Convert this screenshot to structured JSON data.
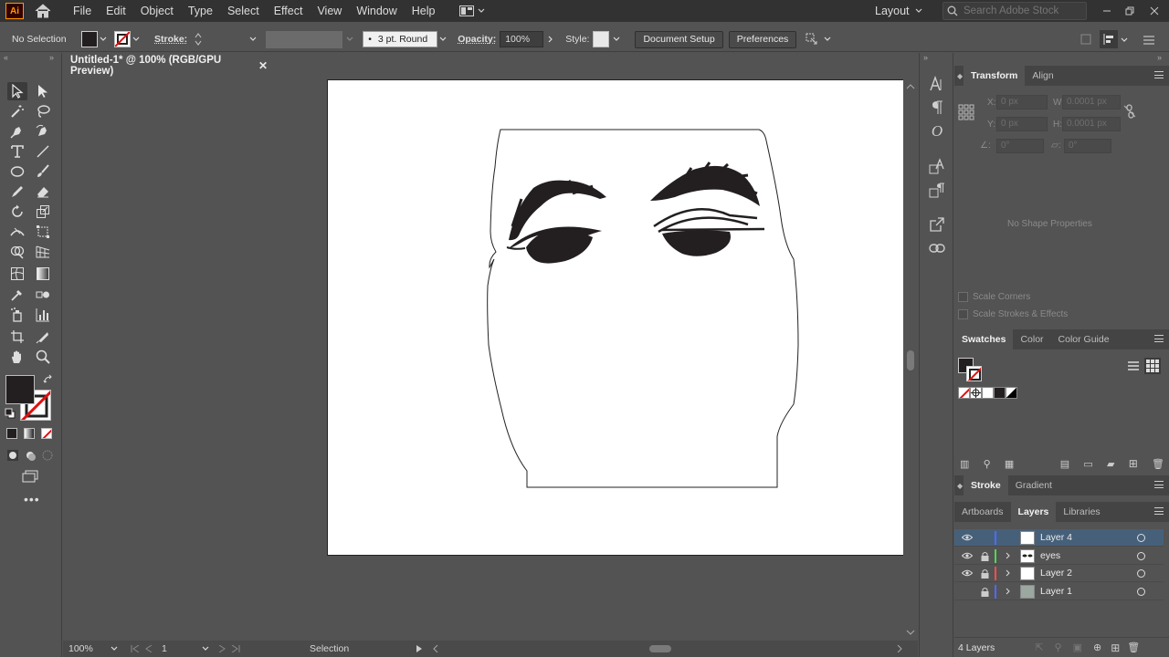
{
  "menubar": {
    "app_logo": "Ai",
    "items": [
      "File",
      "Edit",
      "Object",
      "Type",
      "Select",
      "Effect",
      "View",
      "Window",
      "Help"
    ],
    "workspace": "Layout",
    "search_placeholder": "Search Adobe Stock"
  },
  "controlbar": {
    "selection_label": "No Selection",
    "stroke_label": "Stroke:",
    "brush_value": "3 pt. Round",
    "opacity_label": "Opacity:",
    "opacity_value": "100%",
    "style_label": "Style:",
    "document_setup": "Document Setup",
    "preferences": "Preferences"
  },
  "document": {
    "tab_title": "Untitled-1* @ 100% (RGB/GPU Preview)"
  },
  "statusbar": {
    "zoom": "100%",
    "artboard_number": "1",
    "tool_name": "Selection"
  },
  "transform_panel": {
    "tabs": [
      "Transform",
      "Align"
    ],
    "x_label": "X:",
    "x_value": "0 px",
    "y_label": "Y:",
    "y_value": "0 px",
    "w_label": "W:",
    "w_value": "0.0001 px",
    "h_label": "H:",
    "h_value": "0.0001 px",
    "angle_value": "0°",
    "shear_value": "0°",
    "no_shape": "No Shape Properties",
    "scale_corners": "Scale Corners",
    "scale_strokes": "Scale Strokes & Effects"
  },
  "swatches_panel": {
    "tabs": [
      "Swatches",
      "Color",
      "Color Guide"
    ]
  },
  "stroke_panel": {
    "tabs": [
      "Stroke",
      "Gradient"
    ]
  },
  "layers_panel": {
    "tabs": [
      "Artboards",
      "Layers",
      "Libraries"
    ],
    "layers": [
      {
        "name": "Layer 4",
        "color": "#4f6bff",
        "visible": true,
        "locked": false,
        "selected": true
      },
      {
        "name": "eyes",
        "color": "#4fd84f",
        "visible": true,
        "locked": true,
        "selected": false
      },
      {
        "name": "Layer 2",
        "color": "#ff4f4f",
        "visible": true,
        "locked": true,
        "selected": false
      },
      {
        "name": "Layer 1",
        "color": "#4f6bff",
        "visible": false,
        "locked": true,
        "selected": false
      }
    ],
    "count_label": "4 Layers"
  },
  "colors": {
    "menubar_bg": "#323232",
    "workspace_bg": "#535353",
    "selected_row": "#46607a",
    "fill_swatch": "#231f20"
  }
}
